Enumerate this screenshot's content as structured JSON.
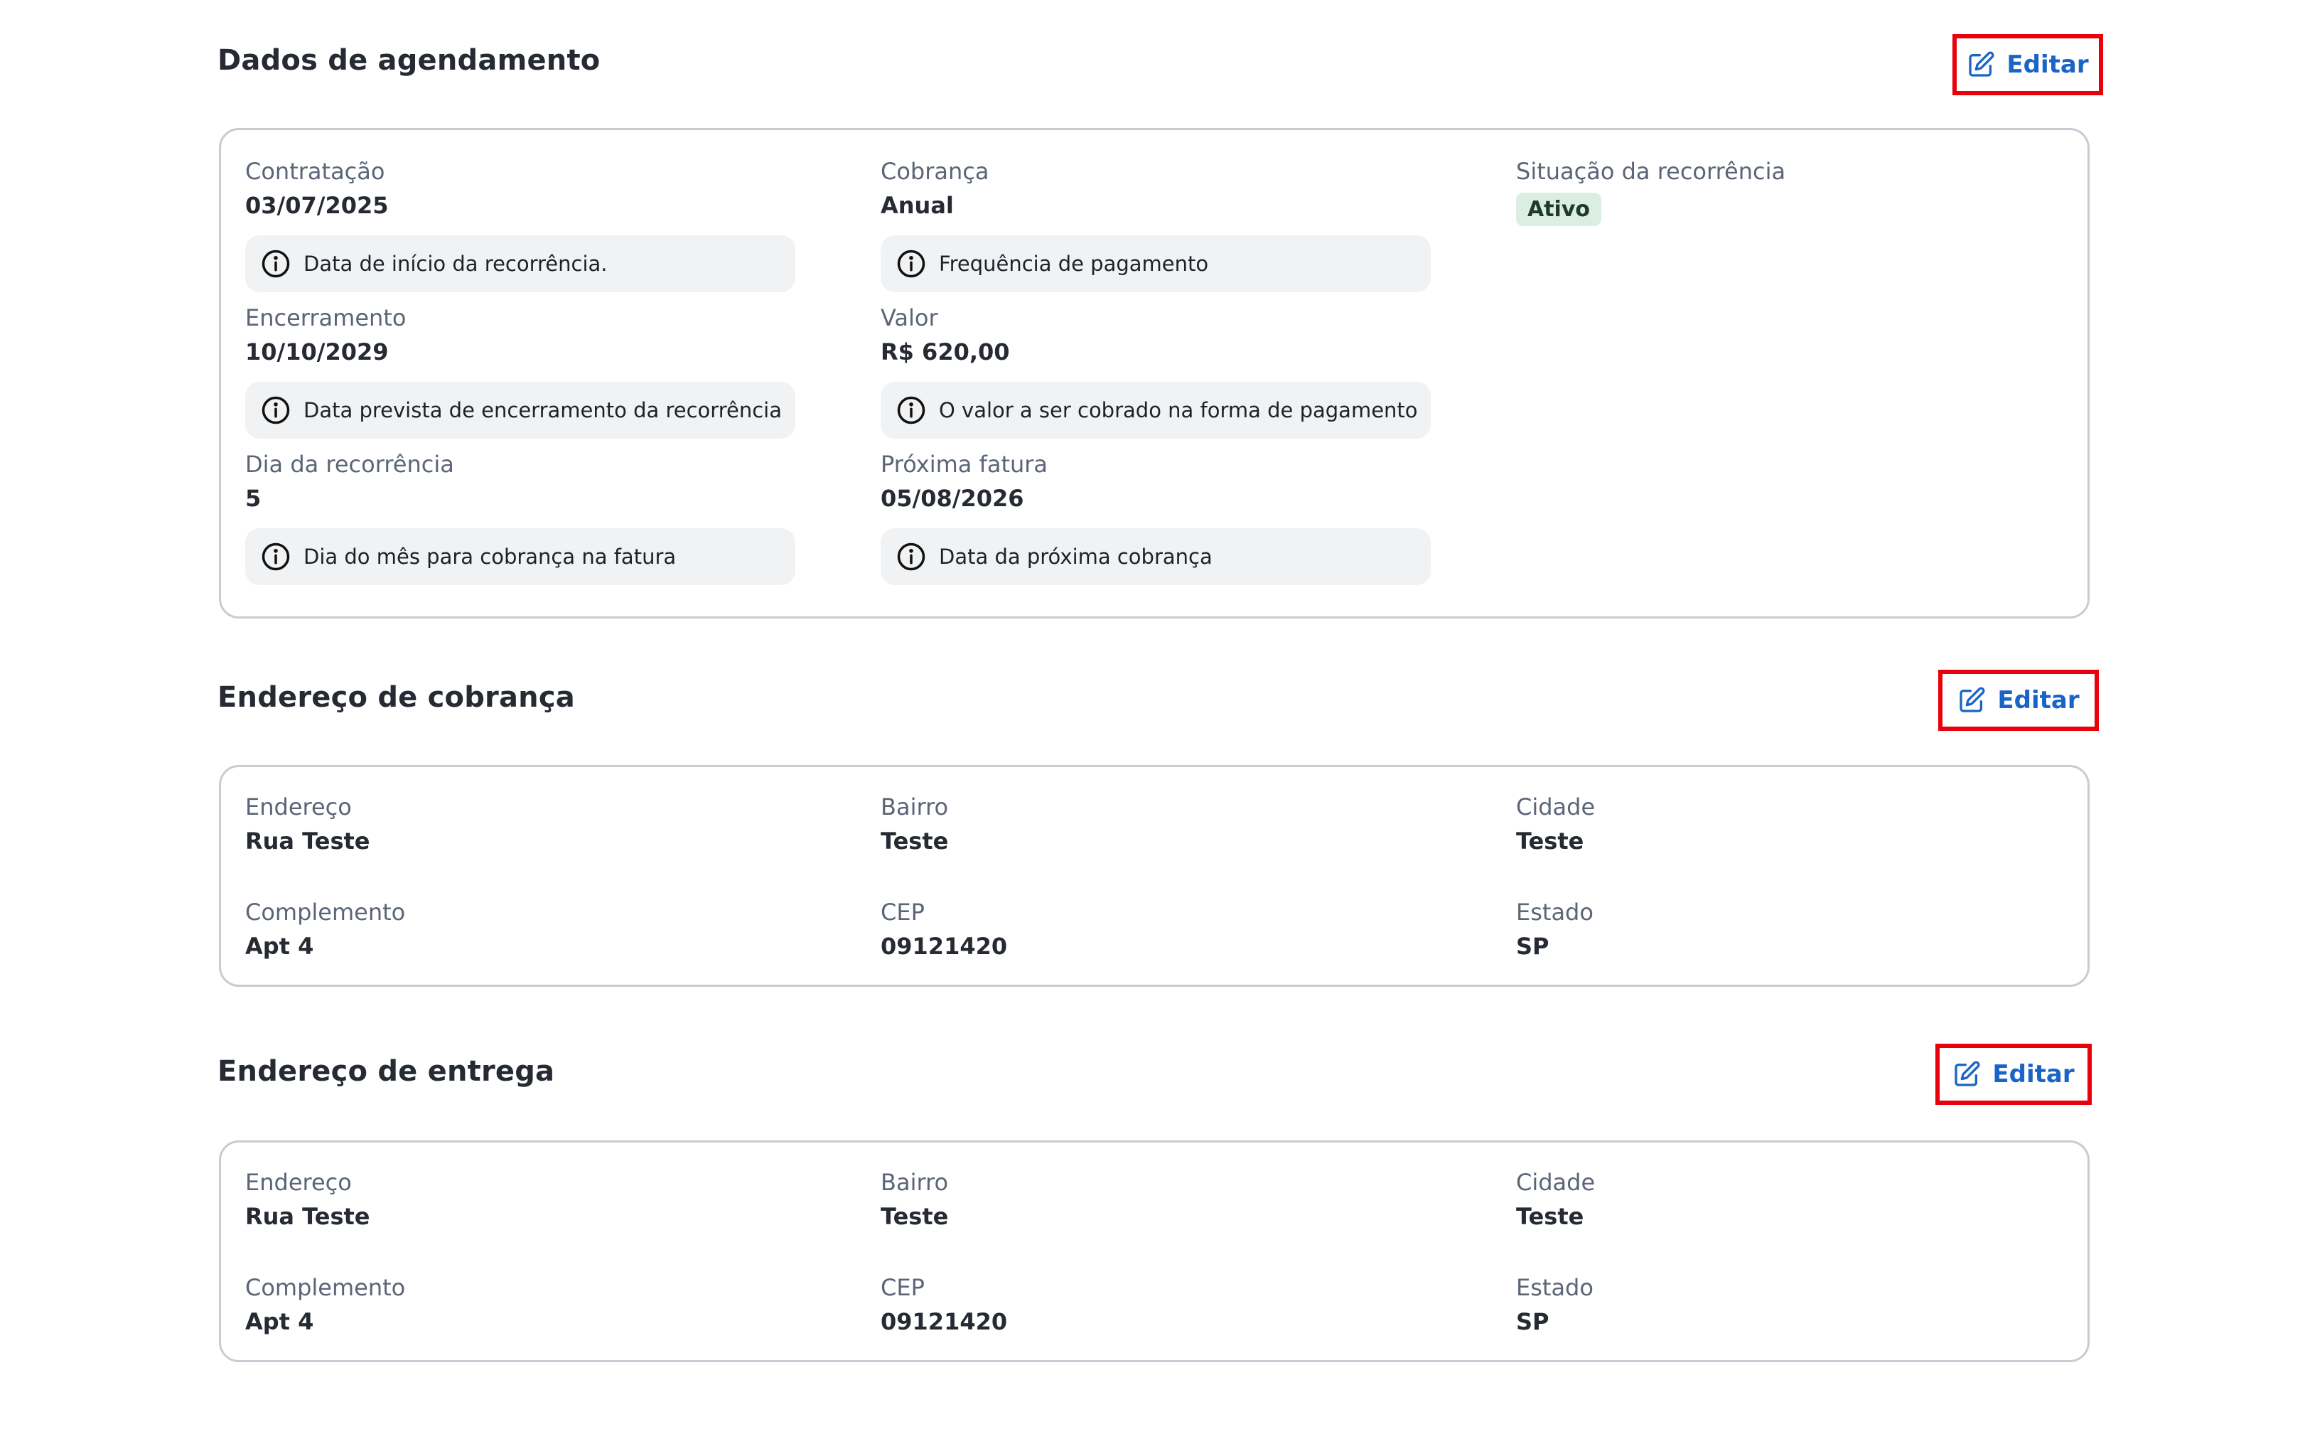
{
  "edit_label": "Editar",
  "scheduling": {
    "title": "Dados de agendamento",
    "contratacao": {
      "label": "Contratação",
      "value": "03/07/2025",
      "hint": "Data de início da recorrência."
    },
    "cobranca": {
      "label": "Cobrança",
      "value": "Anual",
      "hint": "Frequência de pagamento"
    },
    "situacao": {
      "label": "Situação da recorrência",
      "badge": "Ativo"
    },
    "encerramento": {
      "label": "Encerramento",
      "value": "10/10/2029",
      "hint": "Data prevista de encerramento da recorrência"
    },
    "valor": {
      "label": "Valor",
      "value": "R$ 620,00",
      "hint": "O valor a ser cobrado na forma de pagamento"
    },
    "dia": {
      "label": "Dia da recorrência",
      "value": "5",
      "hint": "Dia do mês para cobrança na fatura"
    },
    "proxima": {
      "label": "Próxima fatura",
      "value": "05/08/2026",
      "hint": "Data da próxima cobrança"
    }
  },
  "billing": {
    "title": "Endereço de cobrança",
    "endereco": {
      "label": "Endereço",
      "value": "Rua Teste"
    },
    "bairro": {
      "label": "Bairro",
      "value": "Teste"
    },
    "cidade": {
      "label": "Cidade",
      "value": "Teste"
    },
    "complemento": {
      "label": "Complemento",
      "value": "Apt 4"
    },
    "cep": {
      "label": "CEP",
      "value": "09121420"
    },
    "estado": {
      "label": "Estado",
      "value": "SP"
    }
  },
  "delivery": {
    "title": "Endereço de entrega",
    "endereco": {
      "label": "Endereço",
      "value": "Rua Teste"
    },
    "bairro": {
      "label": "Bairro",
      "value": "Teste"
    },
    "cidade": {
      "label": "Cidade",
      "value": "Teste"
    },
    "complemento": {
      "label": "Complemento",
      "value": "Apt 4"
    },
    "cep": {
      "label": "CEP",
      "value": "09121420"
    },
    "estado": {
      "label": "Estado",
      "value": "SP"
    }
  },
  "colors": {
    "accent": "#1a64c8",
    "highlight_border": "#e8000b",
    "badge_bg": "#dceee1"
  },
  "icons": {
    "edit": "edit-icon",
    "info": "info-icon"
  }
}
